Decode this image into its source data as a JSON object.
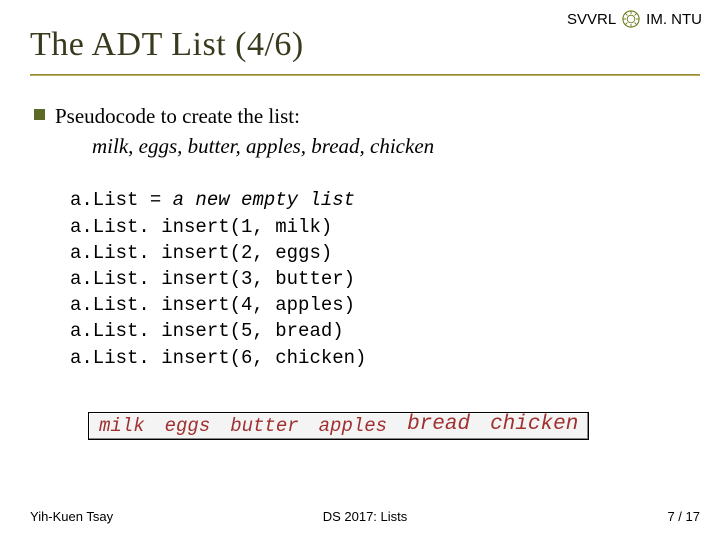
{
  "header": {
    "lab": "SVVRL",
    "affiliation": "IM. NTU"
  },
  "title": "The ADT List (4/6)",
  "bullet": "Pseudocode to create the list:",
  "target_list": "milk, eggs, butter, apples, bread, chicken",
  "code": {
    "line1_prefix": "a.List = ",
    "line1_kw": "a new empty list",
    "l2": "a.List. insert(1, milk)",
    "l3": "a.List. insert(2, eggs)",
    "l4": "a.List. insert(3, butter)",
    "l5": "a.List. insert(4, apples)",
    "l6": "a.List. insert(5, bread)",
    "l7": "a.List. insert(6, chicken)"
  },
  "list_cells": {
    "c1": "milk",
    "c2": "eggs",
    "c3": "butter",
    "c4": "apples",
    "c5": "bread",
    "c6": "chicken"
  },
  "footer": {
    "author": "Yih-Kuen Tsay",
    "course": "DS 2017: Lists",
    "page": "7 / 17"
  }
}
